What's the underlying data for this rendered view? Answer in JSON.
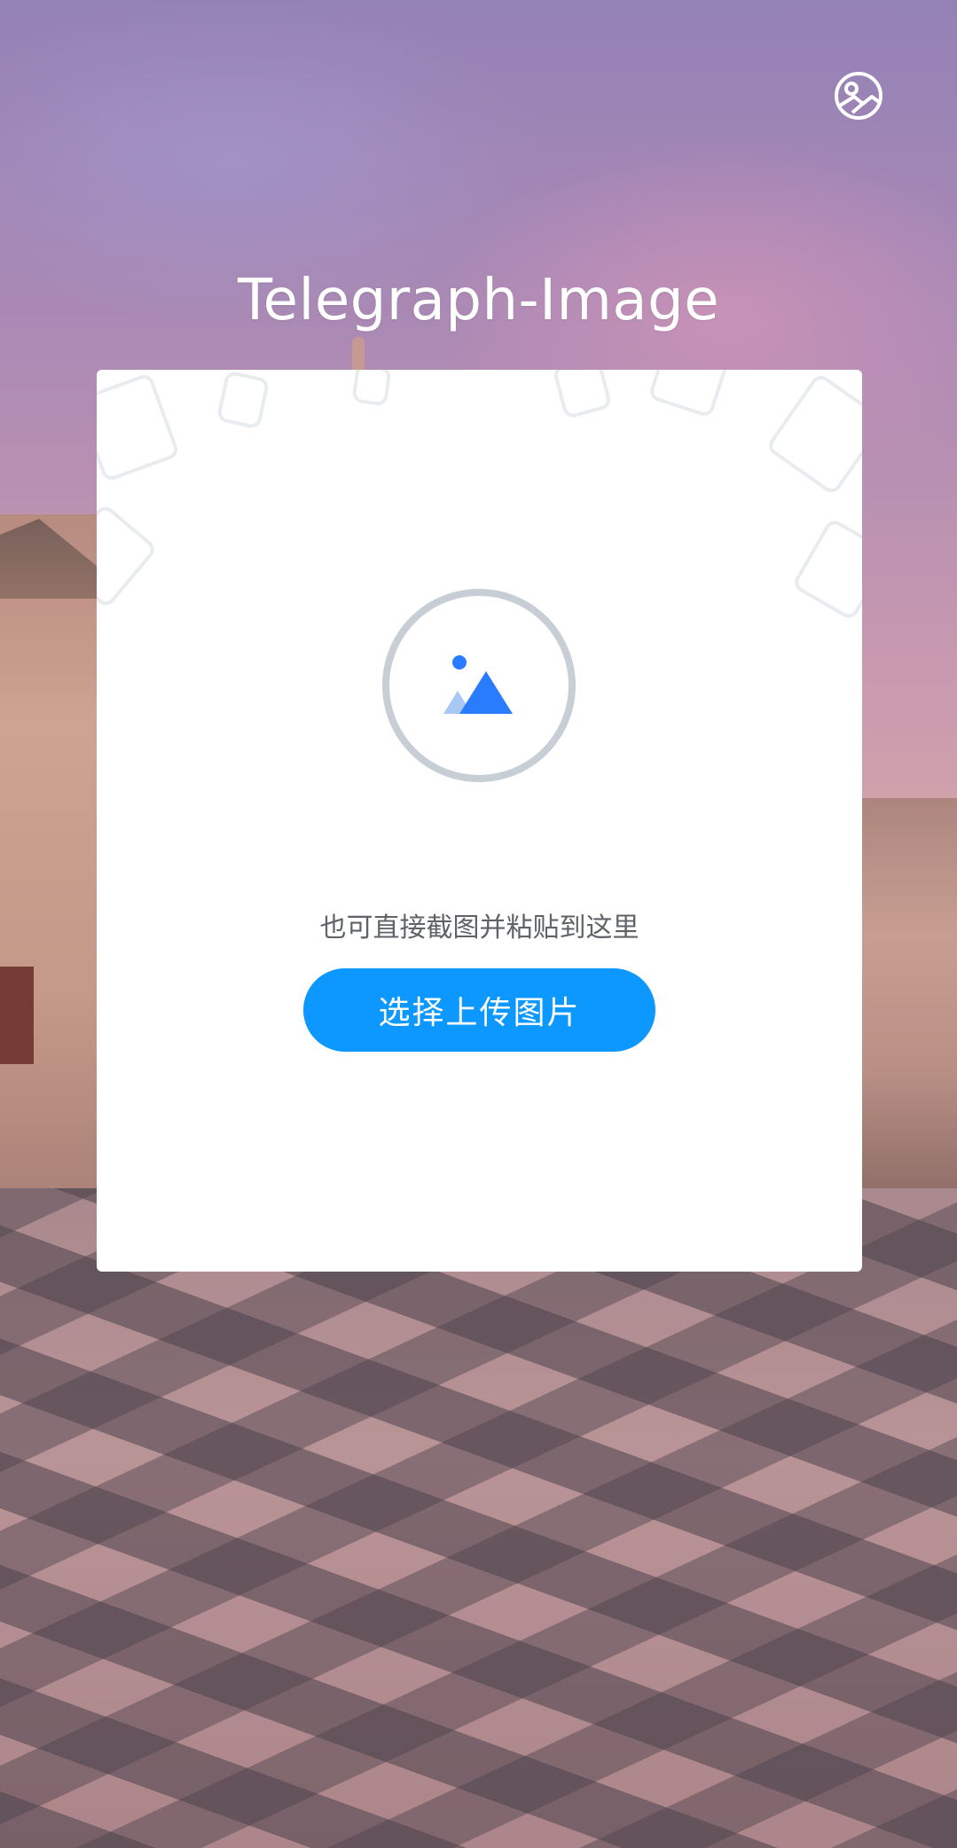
{
  "app": {
    "title": "Telegraph-Image"
  },
  "header": {
    "corner_icon": "image-circle-icon"
  },
  "upload": {
    "icon": "image-mountain-icon",
    "hint": "也可直接截图并粘贴到这里",
    "button_label": "选择上传图片"
  },
  "colors": {
    "accent": "#0d98ff",
    "icon_blue": "#2a7cff",
    "icon_light_blue": "#a9c8f5",
    "circle_border": "#c7ced6",
    "card_bg": "#ffffff",
    "title_text": "#ffffff"
  }
}
